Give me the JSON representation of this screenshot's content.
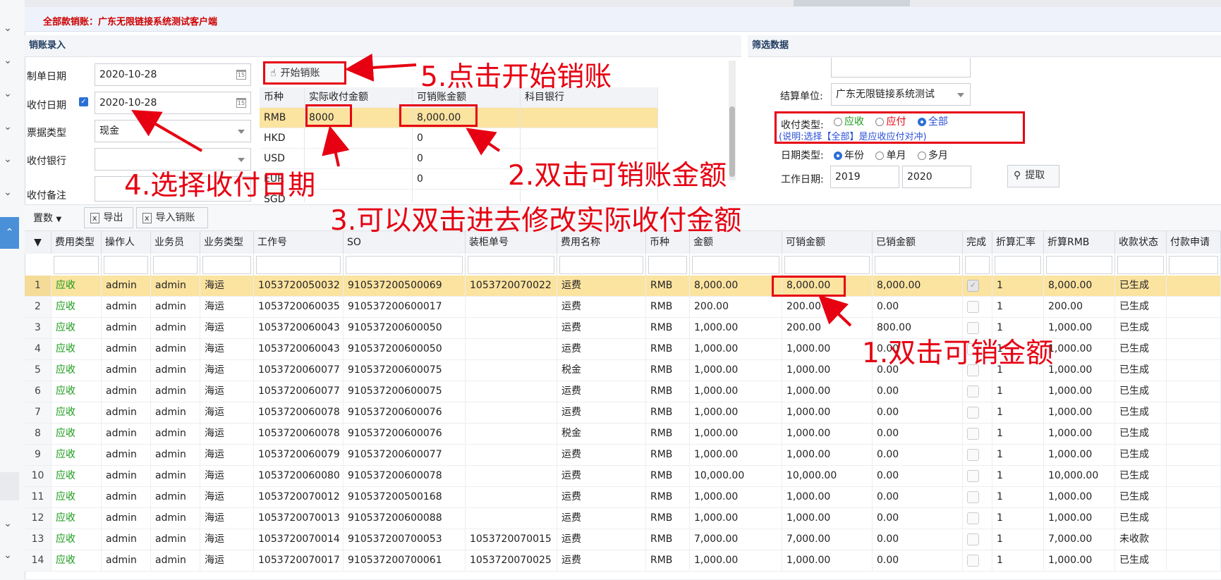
{
  "title_label": "全部款销账：广东无限链接系统测试客户端",
  "entry_section": {
    "title": "销账录入",
    "make_date_label": "制单日期",
    "make_date": "2020-10-28",
    "pay_date_label": "收付日期",
    "pay_date": "2020-10-28",
    "bill_type_label": "票据类型",
    "bill_type": "现金",
    "pay_bank_label": "收付银行",
    "pay_bank": "",
    "remark_label": "收付备注",
    "start_button": "开始销账",
    "mini_grid": {
      "headers": [
        "币种",
        "实际收付金额",
        "可销账金额",
        "科目银行"
      ],
      "rows": [
        {
          "currency": "RMB",
          "actual": "8000",
          "available": "8,000.00",
          "bank": ""
        },
        {
          "currency": "HKD",
          "actual": "",
          "available": "0",
          "bank": ""
        },
        {
          "currency": "USD",
          "actual": "",
          "available": "0",
          "bank": ""
        },
        {
          "currency": "EUR",
          "actual": "",
          "available": "0",
          "bank": ""
        },
        {
          "currency": "SGD",
          "actual": "",
          "available": "",
          "bank": ""
        }
      ]
    }
  },
  "filter_section": {
    "title": "筛选数据",
    "settle_unit_label": "结算单位:",
    "settle_unit": "广东无限链接系统测试",
    "pay_type_label": "收付类型:",
    "pay_type_options": [
      "应收",
      "应付",
      "全部"
    ],
    "pay_type_selected": "全部",
    "pay_type_note": "(说明:选择【全部】是应收应付对冲)",
    "date_type_label": "日期类型:",
    "date_type_options": [
      "年份",
      "单月",
      "多月"
    ],
    "date_type_selected": "年份",
    "work_date_label": "工作日期:",
    "work_date_from": "2019",
    "work_date_to": "2020",
    "fetch_button": "提取"
  },
  "toolbar": {
    "settings": "置数",
    "export": "导出",
    "import": "导入销账"
  },
  "grid": {
    "headers": [
      "费用类型",
      "操作人",
      "业务员",
      "业务类型",
      "工作号",
      "SO",
      "装柜单号",
      "费用名称",
      "币种",
      "金额",
      "可销金额",
      "已销金额",
      "完成",
      "折算汇率",
      "折算RMB",
      "收款状态",
      "付款申请"
    ],
    "rows": [
      {
        "n": "1",
        "fee_type": "应收",
        "operator": "admin",
        "sales": "admin",
        "biz_type": "海运",
        "job_no": "1053720050032",
        "so": "910537200500069",
        "container_no": "1053720070022",
        "fee_name": "运费",
        "currency": "RMB",
        "amount": "8,000.00",
        "available": "8,000.00",
        "settled": "8,000.00",
        "done": true,
        "rate": "1",
        "rmb": "8,000.00",
        "status": "已生成"
      },
      {
        "n": "2",
        "fee_type": "应收",
        "operator": "admin",
        "sales": "admin",
        "biz_type": "海运",
        "job_no": "1053720060035",
        "so": "910537200600017",
        "container_no": "",
        "fee_name": "运费",
        "currency": "RMB",
        "amount": "200.00",
        "available": "200.00",
        "settled": "0.00",
        "done": false,
        "rate": "1",
        "rmb": "200.00",
        "status": "已生成"
      },
      {
        "n": "3",
        "fee_type": "应收",
        "operator": "admin",
        "sales": "admin",
        "biz_type": "海运",
        "job_no": "1053720060043",
        "so": "910537200600050",
        "container_no": "",
        "fee_name": "运费",
        "currency": "RMB",
        "amount": "1,000.00",
        "available": "200.00",
        "settled": "800.00",
        "done": false,
        "rate": "1",
        "rmb": "1,000.00",
        "status": "已生成"
      },
      {
        "n": "4",
        "fee_type": "应收",
        "operator": "admin",
        "sales": "admin",
        "biz_type": "海运",
        "job_no": "1053720060043",
        "so": "910537200600050",
        "container_no": "",
        "fee_name": "运费",
        "currency": "RMB",
        "amount": "1,000.00",
        "available": "1,000.00",
        "settled": "0.00",
        "done": false,
        "rate": "1",
        "rmb": "1,000.00",
        "status": "已生成"
      },
      {
        "n": "5",
        "fee_type": "应收",
        "operator": "admin",
        "sales": "admin",
        "biz_type": "海运",
        "job_no": "1053720060077",
        "so": "910537200600075",
        "container_no": "",
        "fee_name": "税金",
        "currency": "RMB",
        "amount": "1,000.00",
        "available": "1,000.00",
        "settled": "0.00",
        "done": false,
        "rate": "1",
        "rmb": "1,000.00",
        "status": "已生成"
      },
      {
        "n": "6",
        "fee_type": "应收",
        "operator": "admin",
        "sales": "admin",
        "biz_type": "海运",
        "job_no": "1053720060077",
        "so": "910537200600075",
        "container_no": "",
        "fee_name": "运费",
        "currency": "RMB",
        "amount": "1,000.00",
        "available": "1,000.00",
        "settled": "0.00",
        "done": false,
        "rate": "1",
        "rmb": "1,000.00",
        "status": "已生成"
      },
      {
        "n": "7",
        "fee_type": "应收",
        "operator": "admin",
        "sales": "admin",
        "biz_type": "海运",
        "job_no": "1053720060078",
        "so": "910537200600076",
        "container_no": "",
        "fee_name": "运费",
        "currency": "RMB",
        "amount": "1,000.00",
        "available": "1,000.00",
        "settled": "0.00",
        "done": false,
        "rate": "1",
        "rmb": "1,000.00",
        "status": "已生成"
      },
      {
        "n": "8",
        "fee_type": "应收",
        "operator": "admin",
        "sales": "admin",
        "biz_type": "海运",
        "job_no": "1053720060078",
        "so": "910537200600076",
        "container_no": "",
        "fee_name": "税金",
        "currency": "RMB",
        "amount": "1,000.00",
        "available": "1,000.00",
        "settled": "0.00",
        "done": false,
        "rate": "1",
        "rmb": "1,000.00",
        "status": "已生成"
      },
      {
        "n": "9",
        "fee_type": "应收",
        "operator": "admin",
        "sales": "admin",
        "biz_type": "海运",
        "job_no": "1053720060079",
        "so": "910537200600077",
        "container_no": "",
        "fee_name": "运费",
        "currency": "RMB",
        "amount": "1,000.00",
        "available": "1,000.00",
        "settled": "0.00",
        "done": false,
        "rate": "1",
        "rmb": "1,000.00",
        "status": "已生成"
      },
      {
        "n": "10",
        "fee_type": "应收",
        "operator": "admin",
        "sales": "admin",
        "biz_type": "海运",
        "job_no": "1053720060080",
        "so": "910537200600078",
        "container_no": "",
        "fee_name": "运费",
        "currency": "RMB",
        "amount": "10,000.00",
        "available": "10,000.00",
        "settled": "0.00",
        "done": false,
        "rate": "1",
        "rmb": "10,000.00",
        "status": "已生成"
      },
      {
        "n": "11",
        "fee_type": "应收",
        "operator": "admin",
        "sales": "admin",
        "biz_type": "海运",
        "job_no": "1053720070012",
        "so": "910537200500168",
        "container_no": "",
        "fee_name": "运费",
        "currency": "RMB",
        "amount": "1,000.00",
        "available": "1,000.00",
        "settled": "0.00",
        "done": false,
        "rate": "1",
        "rmb": "1,000.00",
        "status": "已生成"
      },
      {
        "n": "12",
        "fee_type": "应收",
        "operator": "admin",
        "sales": "admin",
        "biz_type": "海运",
        "job_no": "1053720070013",
        "so": "910537200600088",
        "container_no": "",
        "fee_name": "运费",
        "currency": "RMB",
        "amount": "1,000.00",
        "available": "1,000.00",
        "settled": "0.00",
        "done": false,
        "rate": "1",
        "rmb": "1,000.00",
        "status": "已生成"
      },
      {
        "n": "13",
        "fee_type": "应收",
        "operator": "admin",
        "sales": "admin",
        "biz_type": "海运",
        "job_no": "1053720070014",
        "so": "910537200700053",
        "container_no": "1053720070015",
        "fee_name": "运费",
        "currency": "RMB",
        "amount": "7,000.00",
        "available": "7,000.00",
        "settled": "0.00",
        "done": false,
        "rate": "1",
        "rmb": "7,000.00",
        "status": "未收款"
      },
      {
        "n": "14",
        "fee_type": "应收",
        "operator": "admin",
        "sales": "admin",
        "biz_type": "海运",
        "job_no": "1053720070017",
        "so": "910537200700061",
        "container_no": "1053720070025",
        "fee_name": "运费",
        "currency": "RMB",
        "amount": "1,000.00",
        "available": "1,000.00",
        "settled": "0.00",
        "done": false,
        "rate": "1",
        "rmb": "1,000.00",
        "status": "已生成"
      }
    ]
  },
  "annotations": {
    "step1": "1.双击可销金额",
    "step2": "2.双击可销账金额",
    "step3": "3.可以双击进去修改实际收付金额",
    "step4": "4.选择收付日期",
    "step5": "5.点击开始销账"
  },
  "colors": {
    "highlight_row": "#fbe3a0",
    "annotation_red": "#e60012",
    "receivable_green": "#1a9b1a",
    "title_red": "#cc0000"
  }
}
